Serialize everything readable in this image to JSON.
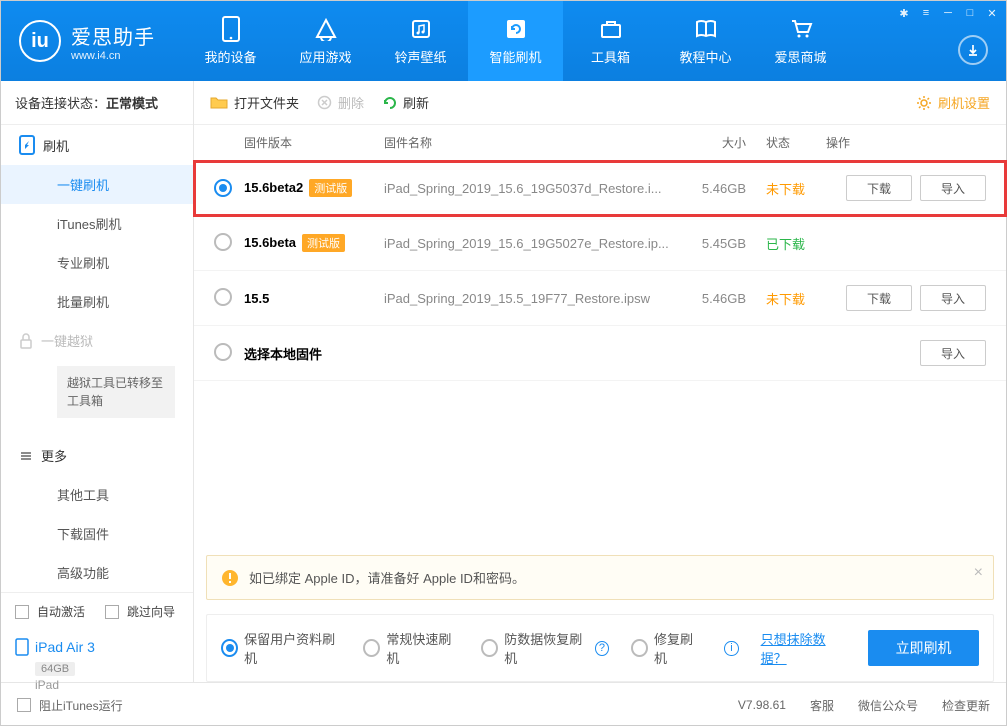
{
  "app": {
    "name_cn": "爱思助手",
    "site": "www.i4.cn"
  },
  "nav": [
    {
      "label": "我的设备"
    },
    {
      "label": "应用游戏"
    },
    {
      "label": "铃声壁纸"
    },
    {
      "label": "智能刷机"
    },
    {
      "label": "工具箱"
    },
    {
      "label": "教程中心"
    },
    {
      "label": "爱思商城"
    }
  ],
  "conn": {
    "prefix": "设备连接状态：",
    "status": "正常模式"
  },
  "side": {
    "flash": "刷机",
    "items": [
      "一键刷机",
      "iTunes刷机",
      "专业刷机",
      "批量刷机"
    ],
    "jailbreak": "一键越狱",
    "jb_box": "越狱工具已转移至工具箱",
    "more": "更多",
    "more_items": [
      "其他工具",
      "下载固件",
      "高级功能"
    ]
  },
  "bottom": {
    "auto": "自动激活",
    "skip": "跳过向导",
    "device": "iPad Air 3",
    "capacity": "64GB",
    "type": "iPad"
  },
  "toolbar": {
    "open": "打开文件夹",
    "delete": "删除",
    "refresh": "刷新",
    "settings": "刷机设置"
  },
  "cols": {
    "ver": "固件版本",
    "name": "固件名称",
    "size": "大小",
    "status": "状态",
    "op": "操作"
  },
  "rows": [
    {
      "selected": true,
      "highlight": true,
      "ver": "15.6beta2",
      "tag": "测试版",
      "name": "iPad_Spring_2019_15.6_19G5037d_Restore.i...",
      "size": "5.46GB",
      "status": "未下载",
      "status_cls": "nd",
      "btns": [
        "下载",
        "导入"
      ]
    },
    {
      "selected": false,
      "ver": "15.6beta",
      "tag": "测试版",
      "name": "iPad_Spring_2019_15.6_19G5027e_Restore.ip...",
      "size": "5.45GB",
      "status": "已下载",
      "status_cls": "dl",
      "btns": []
    },
    {
      "selected": false,
      "ver": "15.5",
      "tag": "",
      "name": "iPad_Spring_2019_15.5_19F77_Restore.ipsw",
      "size": "5.46GB",
      "status": "未下载",
      "status_cls": "nd",
      "btns": [
        "下载",
        "导入"
      ]
    },
    {
      "selected": false,
      "ver": "选择本地固件",
      "tag": "",
      "name": "",
      "size": "",
      "status": "",
      "status_cls": "",
      "btns": [
        "导入"
      ]
    }
  ],
  "banner": "如已绑定 Apple ID，请准备好 Apple ID和密码。",
  "opts": {
    "o1": "保留用户资料刷机",
    "o2": "常规快速刷机",
    "o3": "防数据恢复刷机",
    "o4": "修复刷机",
    "link": "只想抹除数据？",
    "go": "立即刷机"
  },
  "status": {
    "block": "阻止iTunes运行",
    "ver": "V7.98.61",
    "kf": "客服",
    "wx": "微信公众号",
    "upd": "检查更新"
  }
}
